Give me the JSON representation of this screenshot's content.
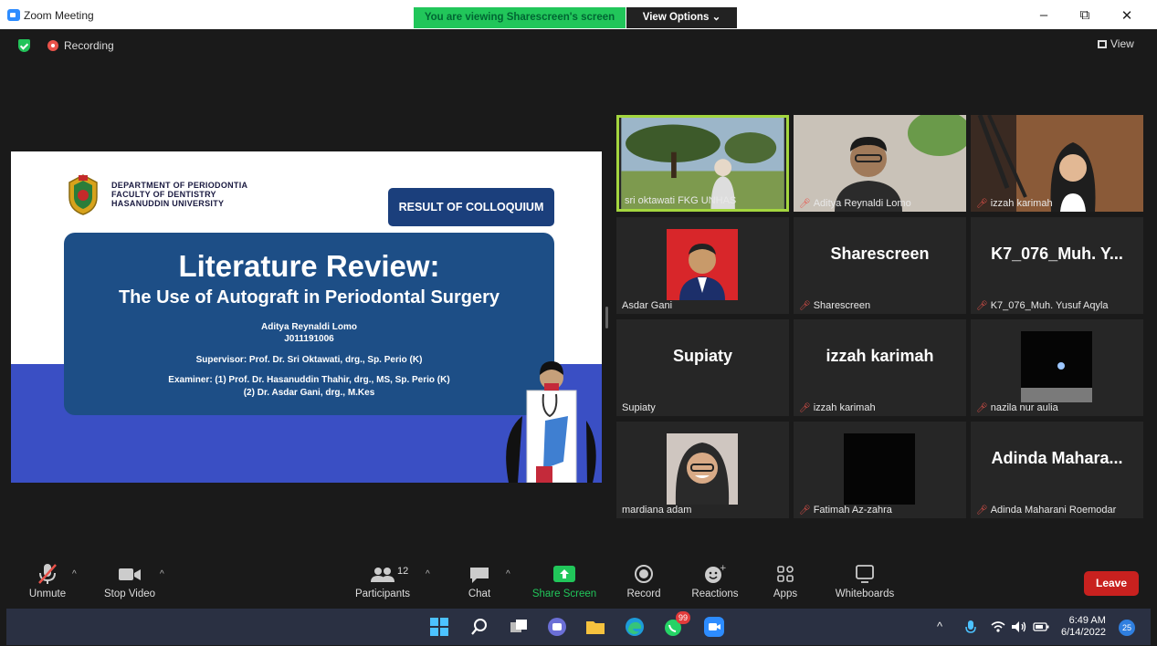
{
  "window": {
    "title": "Zoom Meeting",
    "share_banner": "You are viewing Sharescreen's screen",
    "view_options": "View Options ⌄",
    "minimize": "–",
    "restore": "⧉",
    "close": "✕"
  },
  "meeting": {
    "recording_label": "Recording",
    "view_label": "View"
  },
  "slide": {
    "dept_line1": "DEPARTMENT OF PERIODONTIA",
    "dept_line2": "FACULTY OF DENTISTRY",
    "dept_line3": "HASANUDDIN UNIVERSITY",
    "badge": "RESULT OF COLLOQUIUM",
    "title": "Literature Review:",
    "subtitle": "The Use of Autograft in Periodontal Surgery",
    "author": "Aditya Reynaldi Lomo",
    "student_id": "J011191006",
    "supervisor": "Supervisor: Prof. Dr. Sri Oktawati, drg., Sp. Perio (K)",
    "examiner1": "Examiner: (1) Prof. Dr. Hasanuddin Thahir, drg., MS, Sp. Perio (K)",
    "examiner2": "(2) Dr. Asdar Gani, drg., M.Kes"
  },
  "participants": [
    {
      "name": "sri oktawati FKG UNHAS",
      "muted": false,
      "type": "video-outdoor",
      "active": true
    },
    {
      "name": "Aditya Reynaldi Lomo",
      "muted": true,
      "type": "video-man"
    },
    {
      "name": "izzah karimah",
      "muted": true,
      "type": "video-woman"
    },
    {
      "name": "Asdar Gani",
      "muted": false,
      "type": "photo-red"
    },
    {
      "name": "Sharescreen",
      "muted": true,
      "type": "text",
      "display": "Sharescreen"
    },
    {
      "name": "K7_076_Muh. Yusuf Aqyla",
      "muted": true,
      "type": "text",
      "display": "K7_076_Muh. Y..."
    },
    {
      "name": "Supiaty",
      "muted": false,
      "type": "text",
      "display": "Supiaty"
    },
    {
      "name": "izzah karimah",
      "muted": true,
      "type": "text",
      "display": "izzah karimah"
    },
    {
      "name": "nazila nur aulia",
      "muted": true,
      "type": "photo-earth"
    },
    {
      "name": "mardiana adam",
      "muted": false,
      "type": "photo-woman"
    },
    {
      "name": "Fatimah Az-zahra",
      "muted": true,
      "type": "photo-black"
    },
    {
      "name": "Adinda Maharani Roemodar",
      "muted": true,
      "type": "text",
      "display": "Adinda  Mahara..."
    }
  ],
  "toolbar": {
    "unmute": "Unmute",
    "stop_video": "Stop Video",
    "participants": "Participants",
    "participants_count": "12",
    "chat": "Chat",
    "share_screen": "Share Screen",
    "record": "Record",
    "reactions": "Reactions",
    "apps": "Apps",
    "whiteboards": "Whiteboards",
    "leave": "Leave"
  },
  "taskbar": {
    "time": "6:49 AM",
    "date": "6/14/2022",
    "whatsapp_badge": "99",
    "notifications": "25"
  },
  "colors": {
    "share_green": "#21c65a",
    "leave_red": "#c8211f",
    "active_speaker": "#a4d63f",
    "slide_blue": "#1d4e86"
  }
}
